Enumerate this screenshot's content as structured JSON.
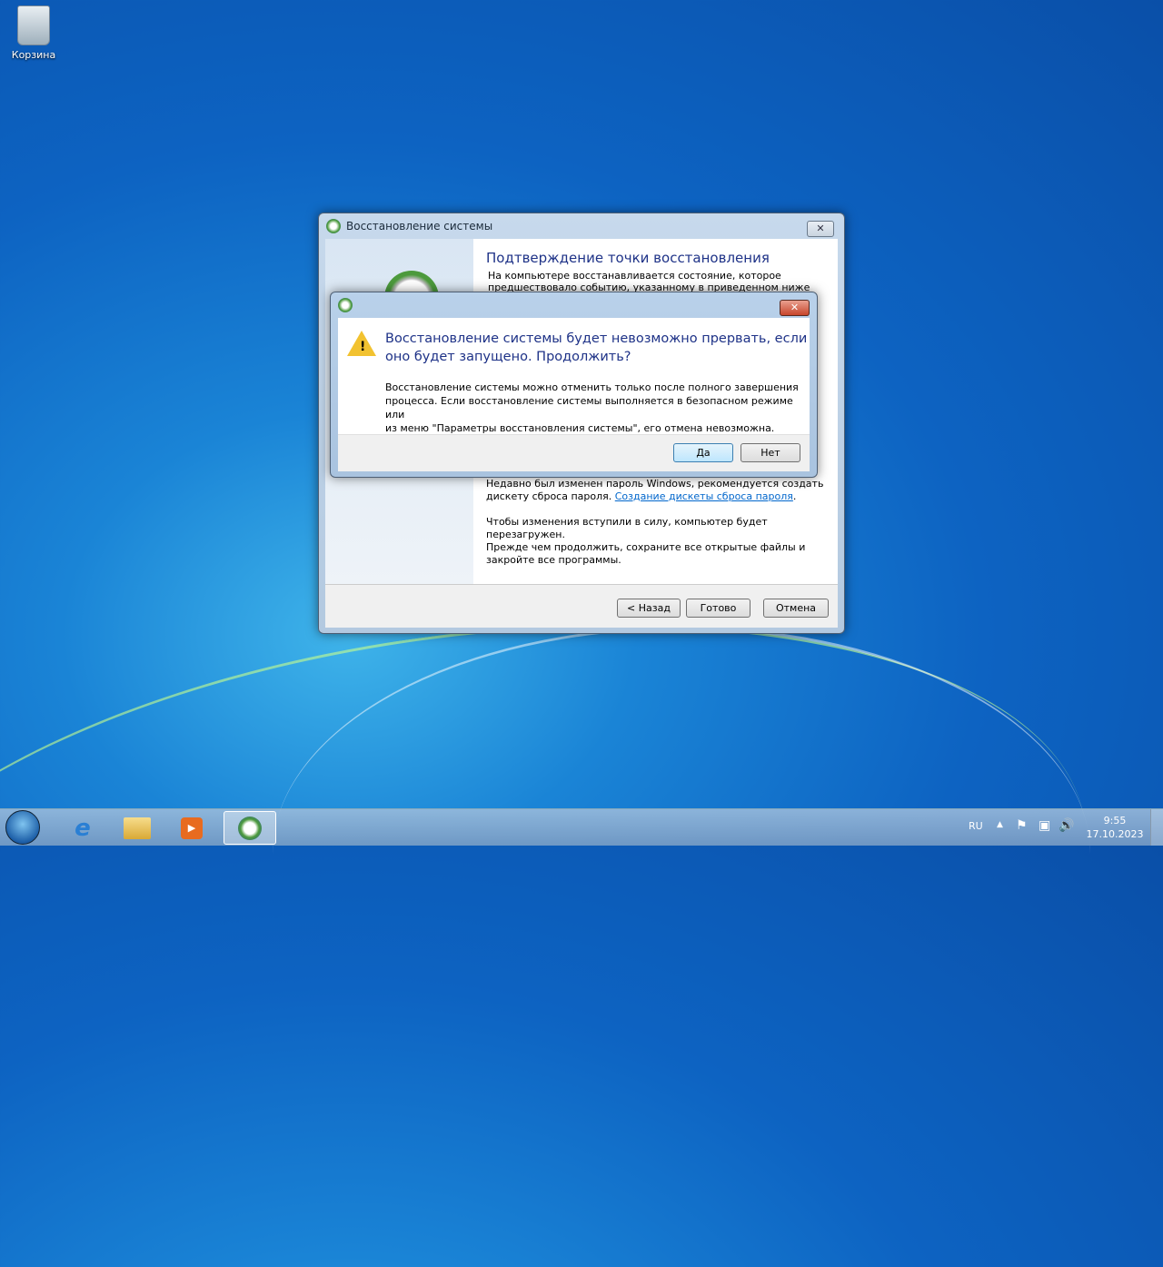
{
  "desktop": {
    "recycle_bin": "Корзина"
  },
  "wizard": {
    "title": "Восстановление системы",
    "heading": "Подтверждение точки восстановления",
    "intro_line1": "На компьютере восстанавливается состояние, которое",
    "intro_line2": "предшествовало событию, указанному в приведенном ниже поле",
    "password_text1": "Недавно был изменен пароль Windows, рекомендуется создать",
    "password_text2": "дискету сброса пароля.",
    "password_link": "Создание дискеты сброса пароля",
    "reboot1": "Чтобы изменения вступили в силу, компьютер будет перезагружен.",
    "reboot2": "Прежде чем продолжить, сохраните все открытые файлы и",
    "reboot3": "закройте все программы.",
    "back": "< Назад",
    "finish": "Готово",
    "cancel": "Отмена",
    "close": "✕"
  },
  "confirm": {
    "heading1": "Восстановление системы будет невозможно прервать, если",
    "heading2": "оно будет запущено. Продолжить?",
    "body1": "Восстановление системы можно отменить только после полного завершения",
    "body2": "процесса. Если восстановление системы выполняется в безопасном режиме или",
    "body3": "из меню \"Параметры восстановления системы\", его отмена невозможна.",
    "yes": "Да",
    "no": "Нет",
    "close": "✕"
  },
  "tray": {
    "lang": "RU",
    "time": "9:55",
    "date": "17.10.2023"
  },
  "colors": {
    "heading_blue": "#1e3287",
    "link": "#0066cc"
  }
}
